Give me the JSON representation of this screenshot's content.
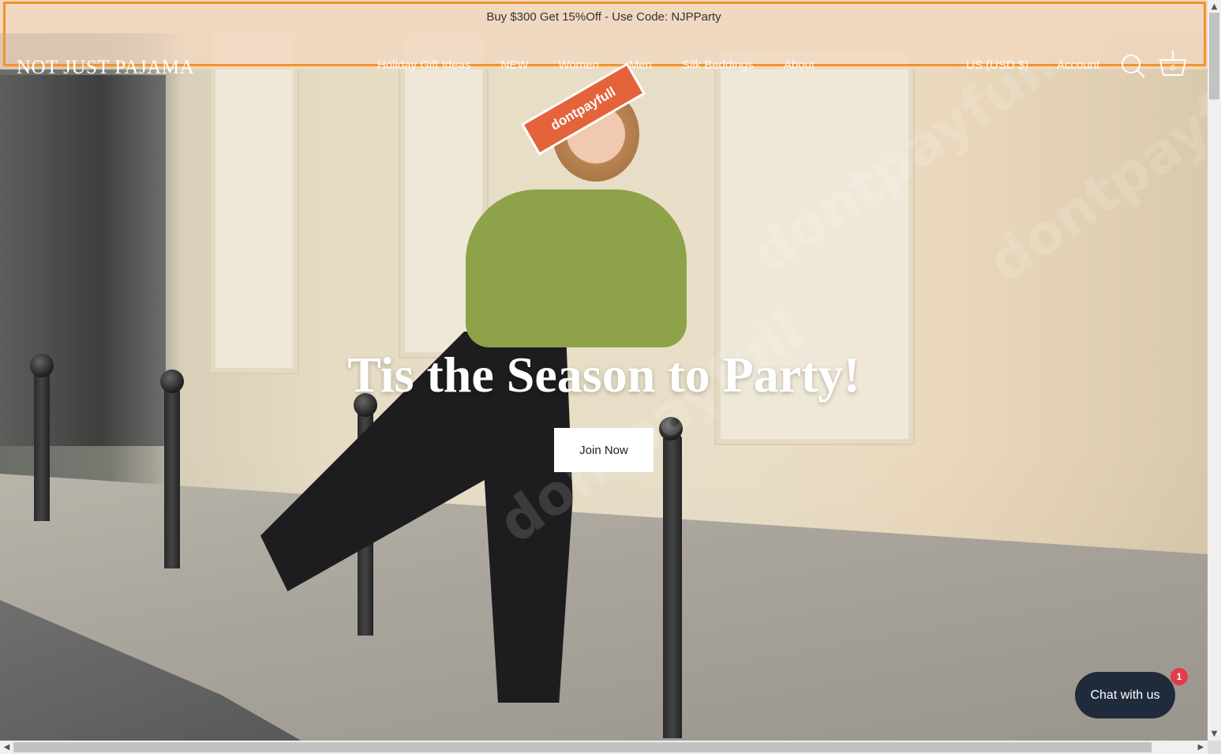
{
  "announcement": {
    "text": "Buy $300 Get 15%Off - Use Code: NJPParty"
  },
  "header": {
    "logo": "NOT JUST PAJAMA",
    "nav": [
      "Holiday Gift Ideas",
      "NEW",
      "Women",
      "Men",
      "Silk Beddings",
      "About"
    ],
    "currency": "US (USD $)",
    "account": "Account",
    "cart_count": "0"
  },
  "overlay_badge": "dontpayfull",
  "hero": {
    "title": "Tis the Season to Party!",
    "cta": "Join Now"
  },
  "chat": {
    "label": "Chat with us",
    "unread": "1"
  },
  "colors": {
    "announcement_bg": "#f1d8c0",
    "highlight": "#f3932d",
    "chat_bg": "#1f2a3a",
    "chat_badge": "#e43b4a",
    "badge_bg": "#e5633a"
  },
  "icons": [
    "search-icon",
    "cart-icon",
    "chevron-down-icon"
  ]
}
